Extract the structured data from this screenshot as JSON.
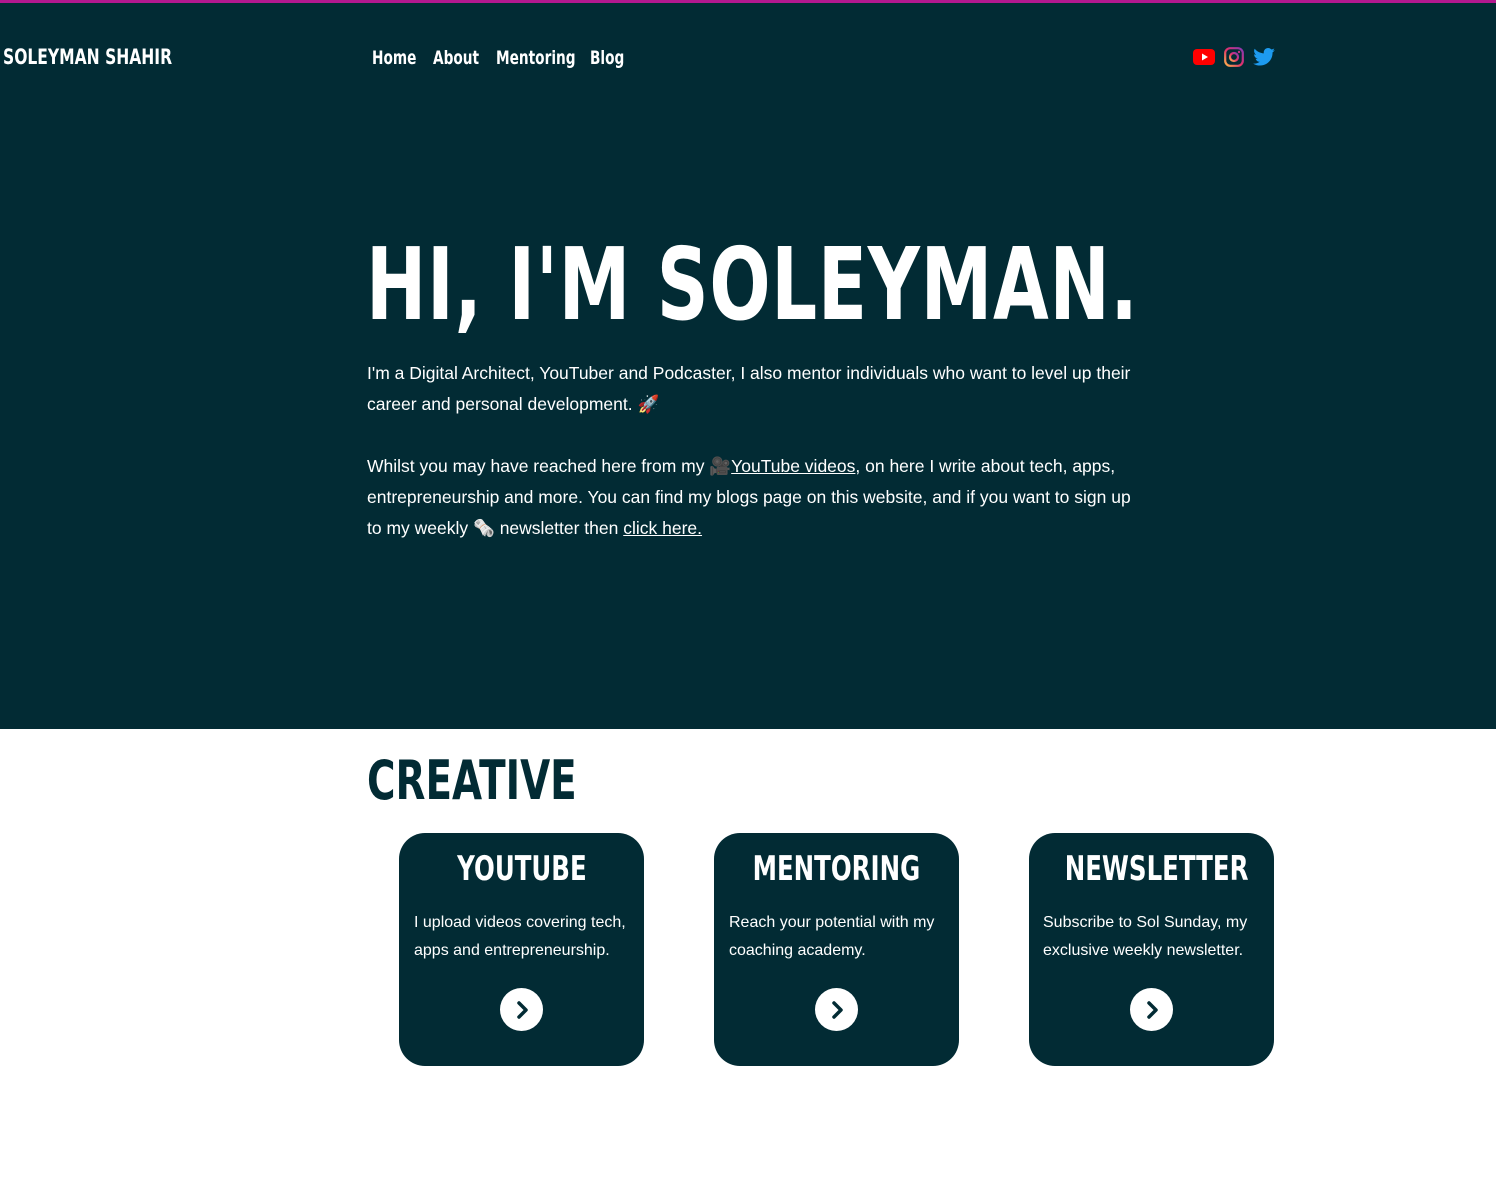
{
  "header": {
    "site_title": "SOLEYMAN SHAHIR",
    "nav": [
      "Home",
      "About",
      "Mentoring",
      "Blog"
    ],
    "social": [
      "youtube-icon",
      "instagram-icon",
      "twitter-icon"
    ]
  },
  "hero": {
    "title": "HI, I'M SOLEYMAN.",
    "intro_1": "I'm a Digital Architect, YouTuber and Podcaster, I also mentor individuals who want to level up their career and personal development.",
    "intro_1_emoji": "🚀",
    "intro_2_part1": "Whilst you may have reached here from my",
    "intro_2_emoji_camera": "🎥",
    "youtube_link": "YouTube videos",
    "intro_2_part2": ", on here I write about tech, apps, entrepreneurship and more. You can find my blogs page on this website, and if you want to sign up to my weekly",
    "intro_2_emoji_paper": "🗞️",
    "intro_2_part3": "newsletter then",
    "newsletter_link": "click here."
  },
  "section": {
    "title": "CREATIVE"
  },
  "cards": [
    {
      "title": "YOUTUBE",
      "description": "I upload videos covering tech, apps and entrepreneurship."
    },
    {
      "title": "MENTORING",
      "description": "Reach your potential with my coaching academy."
    },
    {
      "title": "NEWSLETTER",
      "description": "Subscribe to Sol Sunday, my exclusive weekly newsletter."
    }
  ],
  "colors": {
    "primary": "#022b34",
    "accent": "#b3188f",
    "youtube_red": "#ff0000",
    "twitter_blue": "#1d9bf0"
  }
}
